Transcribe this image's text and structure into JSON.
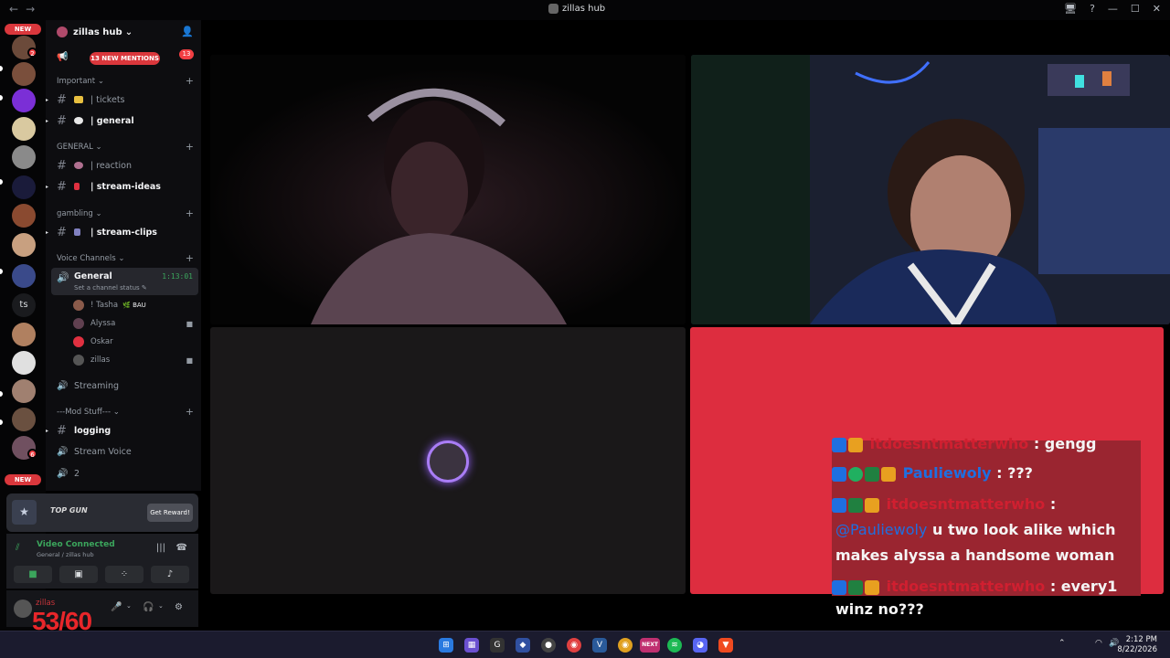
{
  "window": {
    "title": "zillas hub",
    "nav_back": "←",
    "nav_forward": "→",
    "controls": [
      "🖥",
      "?",
      "—",
      "☐",
      "✕"
    ]
  },
  "guilds": {
    "new_top": "NEW",
    "new_bottom": "NEW",
    "ts_label": "ts",
    "badge_1": "2",
    "badge_2": "6"
  },
  "server": {
    "name": "zillas hub",
    "chevron": "⌄",
    "mentions_banner": "13 NEW MENTIONS",
    "mentions_count": "13"
  },
  "channels": {
    "cat_important": "Important ⌄",
    "tickets": "| tickets",
    "general": "| general",
    "cat_general": "GENERAL ⌄",
    "reaction": "| reaction",
    "stream_ideas": "| stream-ideas",
    "cat_gambling": "gambling ⌄",
    "stream_clips": "| stream-clips",
    "cat_voice": "Voice Channels ⌄",
    "voice_general": "General",
    "voice_timer": "1:13:01",
    "voice_status": "Set a channel status ✎",
    "streaming": "Streaming",
    "cat_mod": "---Mod Stuff--- ⌄",
    "logging": "logging",
    "stream_voice": "Stream Voice",
    "voice_2": "2"
  },
  "members": [
    {
      "name": "! Tasha",
      "tag": "🌿 BAU"
    },
    {
      "name": "Alyssa"
    },
    {
      "name": "Oskar"
    },
    {
      "name": "zillas"
    }
  ],
  "promo": {
    "brand": "TOP GUN",
    "logo": "★",
    "button": "Get Reward!"
  },
  "rtc": {
    "status": "Video Connected",
    "sub": "General / zillas hub"
  },
  "user": {
    "name": "zillas"
  },
  "fps_counter": "53/60",
  "chat": {
    "line1_user": "itdoesntmatterwho",
    "line1_msg": " : gengg",
    "line2_user": "Pauliewoly",
    "line2_msg": " : ???",
    "line3_user": "itdoesntmatterwho",
    "line3_msg": " :",
    "line3_mention": "@Pauliewoly",
    "line3_text1": " u two look alike which",
    "line3_text2": "makes alyssa a handsome woman",
    "line4_user": "itdoesntmatterwho",
    "line4_msg": " : every1",
    "line5": "winz no???"
  },
  "taskbar": {
    "time": "2:12 PM",
    "date": "8/22/2026",
    "next_label": "NEXT",
    "tray_up": "⌃"
  },
  "colors": {
    "accent_green": "#3ba55c",
    "mention_red": "#da373c",
    "stream_bg_red": "#dd2d3f",
    "speaking_ring": "#a97df5"
  }
}
